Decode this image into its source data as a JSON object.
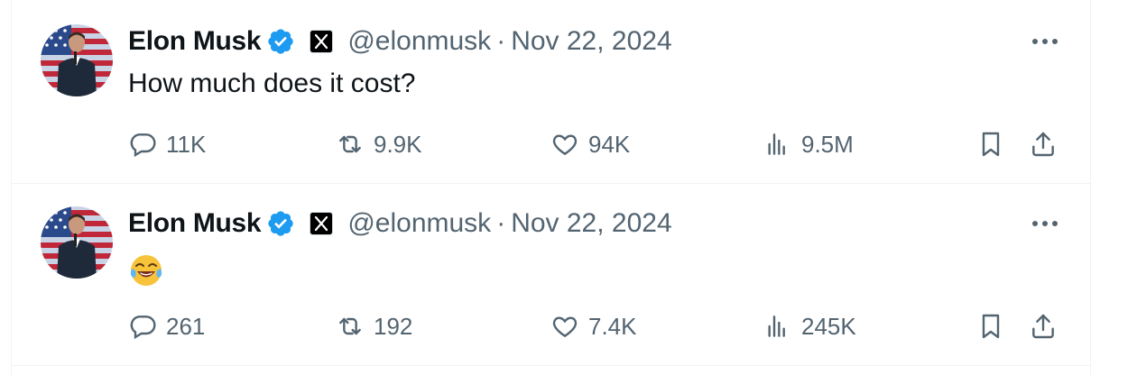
{
  "tweets": [
    {
      "author_name": "Elon Musk",
      "handle": "@elonmusk",
      "separator": "·",
      "date": "Nov 22, 2024",
      "text": "How much does it cost?",
      "emoji": "",
      "replies": "11K",
      "reposts": "9.9K",
      "likes": "94K",
      "views": "9.5M"
    },
    {
      "author_name": "Elon Musk",
      "handle": "@elonmusk",
      "separator": "·",
      "date": "Nov 22, 2024",
      "text": "",
      "emoji": "😂",
      "replies": "261",
      "reposts": "192",
      "likes": "7.4K",
      "views": "245K"
    }
  ],
  "icons": {
    "verified": "verified-badge-icon",
    "affiliation": "x-logo-icon",
    "more": "more-icon",
    "reply": "reply-icon",
    "repost": "repost-icon",
    "like": "heart-icon",
    "views": "views-icon",
    "bookmark": "bookmark-icon",
    "share": "share-icon"
  },
  "colors": {
    "text_primary": "#0f1419",
    "text_secondary": "#536471",
    "verified_blue": "#1d9bf0",
    "border": "#eff3f4"
  }
}
